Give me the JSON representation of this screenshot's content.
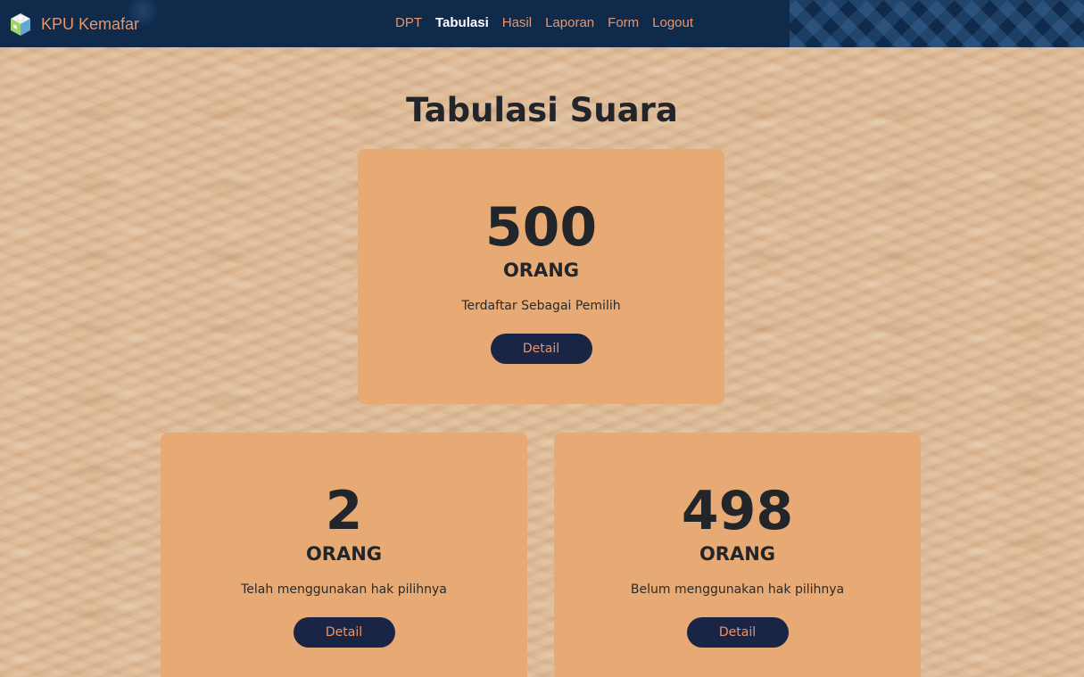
{
  "navbar": {
    "brand": "KPU Kemafar",
    "links": [
      {
        "label": "DPT"
      },
      {
        "label": "Tabulasi"
      },
      {
        "label": "Hasil"
      },
      {
        "label": "Laporan"
      },
      {
        "label": "Form"
      },
      {
        "label": "Logout"
      }
    ],
    "active": "Tabulasi",
    "background_color": "#0f2a4b",
    "link_color": "#e8956a",
    "logo_icon": "ballot-box-icon"
  },
  "page": {
    "title": "Tabulasi Suara"
  },
  "cards": [
    {
      "number": "500",
      "unit": "ORANG",
      "description": "Terdaftar Sebagai Pemilih",
      "button": "Detail"
    },
    {
      "number": "2",
      "unit": "ORANG",
      "description": "Telah menggunakan hak pilihnya",
      "button": "Detail"
    },
    {
      "number": "498",
      "unit": "ORANG",
      "description": "Belum menggunakan hak pilihnya",
      "button": "Detail"
    }
  ],
  "colors": {
    "card_background": "#e8aa74",
    "button_background": "#1a2545",
    "page_background": "#dcb894"
  }
}
